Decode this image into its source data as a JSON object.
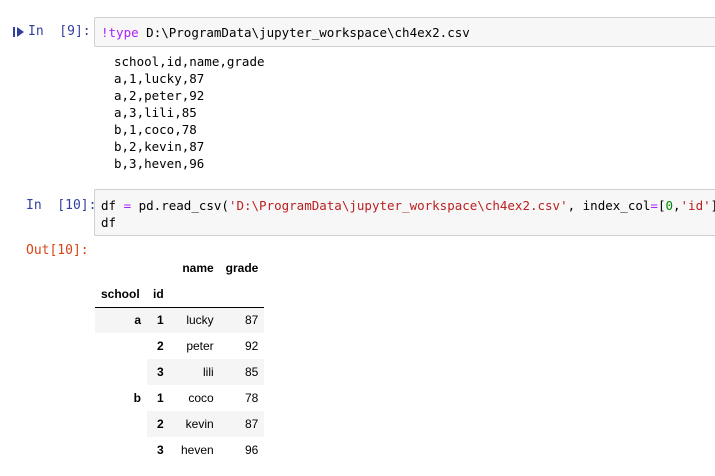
{
  "cells": [
    {
      "prompt": "In  [9]:",
      "code": {
        "bang": "!",
        "kw": "type",
        "rest": " D:\\ProgramData\\jupyter_workspace\\ch4ex2.csv"
      },
      "output_lines": [
        "school,id,name,grade",
        "a,1,lucky,87",
        "a,2,peter,92",
        "a,3,lili,85",
        "b,1,coco,78",
        "b,2,kevin,87",
        "b,3,heven,96"
      ]
    },
    {
      "prompt": "In  [10]:",
      "code_line1": {
        "p1": "df ",
        "eq": "=",
        "p2": " pd.read_csv(",
        "str1": "'D:\\ProgramData\\jupyter_workspace\\ch4ex2.csv'",
        "p3": ", index_col",
        "eq2": "=",
        "p4": "[",
        "n0": "0",
        "p5": ",",
        "str2": "'id'",
        "p6": "])"
      },
      "code_line2": "df",
      "out_prompt": "Out[10]:",
      "table": {
        "columns": [
          "name",
          "grade"
        ],
        "index_names": [
          "school",
          "id"
        ],
        "rows": [
          {
            "school": "a",
            "id": "1",
            "name": "lucky",
            "grade": "87"
          },
          {
            "school": "",
            "id": "2",
            "name": "peter",
            "grade": "92"
          },
          {
            "school": "",
            "id": "3",
            "name": "lili",
            "grade": "85"
          },
          {
            "school": "b",
            "id": "1",
            "name": "coco",
            "grade": "78"
          },
          {
            "school": "",
            "id": "2",
            "name": "kevin",
            "grade": "87"
          },
          {
            "school": "",
            "id": "3",
            "name": "heven",
            "grade": "96"
          }
        ]
      }
    }
  ],
  "colors": {
    "in_prompt": "#303f9f",
    "out_prompt": "#d84315",
    "cell_bg": "#f7f7f7",
    "cell_border": "#cfcfcf"
  }
}
